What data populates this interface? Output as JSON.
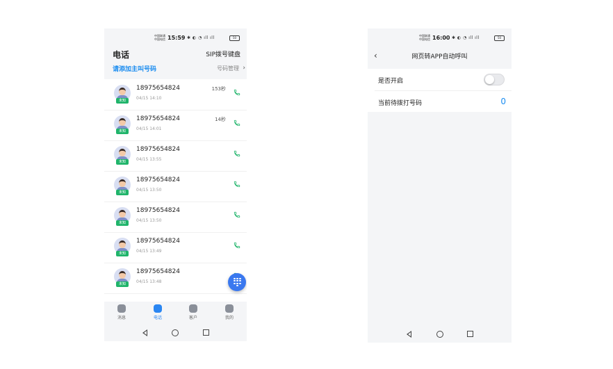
{
  "phone1": {
    "status": {
      "carrier1": "中国联通",
      "carrier2": "中国电信",
      "time": "15:59",
      "icons": "✱ ◐ ◔ ıll ıll",
      "battery": "50"
    },
    "header": {
      "title": "电话",
      "sip_keyboard": "SIP拨号键盘",
      "add_number": "请添加主叫号码",
      "manage": "号码管理",
      "chevron": "›"
    },
    "calls": [
      {
        "tag": "未知",
        "number": "18975654824",
        "datetime": "04/15 14:10",
        "duration": "153秒"
      },
      {
        "tag": "未知",
        "number": "18975654824",
        "datetime": "04/15 14:01",
        "duration": "14秒"
      },
      {
        "tag": "未知",
        "number": "18975654824",
        "datetime": "04/15 13:55",
        "duration": ""
      },
      {
        "tag": "未知",
        "number": "18975654824",
        "datetime": "04/15 13:50",
        "duration": ""
      },
      {
        "tag": "未知",
        "number": "18975654824",
        "datetime": "04/15 13:50",
        "duration": ""
      },
      {
        "tag": "未知",
        "number": "18975654824",
        "datetime": "04/15 13:49",
        "duration": ""
      },
      {
        "tag": "未知",
        "number": "18975654824",
        "datetime": "04/15 13:48",
        "duration": ""
      }
    ],
    "tabs": [
      {
        "label": "消息",
        "icon": "message-icon",
        "active": false
      },
      {
        "label": "电话",
        "icon": "phone-icon",
        "active": true
      },
      {
        "label": "客户",
        "icon": "contact-icon",
        "active": false
      },
      {
        "label": "我的",
        "icon": "profile-icon",
        "active": false
      }
    ],
    "colors": {
      "accent": "#2a86f2",
      "tag_green": "#1fb46a",
      "call_green": "#1fb46a",
      "fab": "#3a78ef"
    }
  },
  "phone2": {
    "status": {
      "carrier1": "中国联通",
      "carrier2": "中国电信",
      "time": "16:00",
      "icons": "✱ ◐ ◔ ıll ıll",
      "battery": "50"
    },
    "header": {
      "back": "‹",
      "title": "网页转APP自动呼叫"
    },
    "settings": {
      "enable_label": "是否开启",
      "enabled": false,
      "pending_label": "当前待拨打号码",
      "pending_value": "0"
    }
  }
}
